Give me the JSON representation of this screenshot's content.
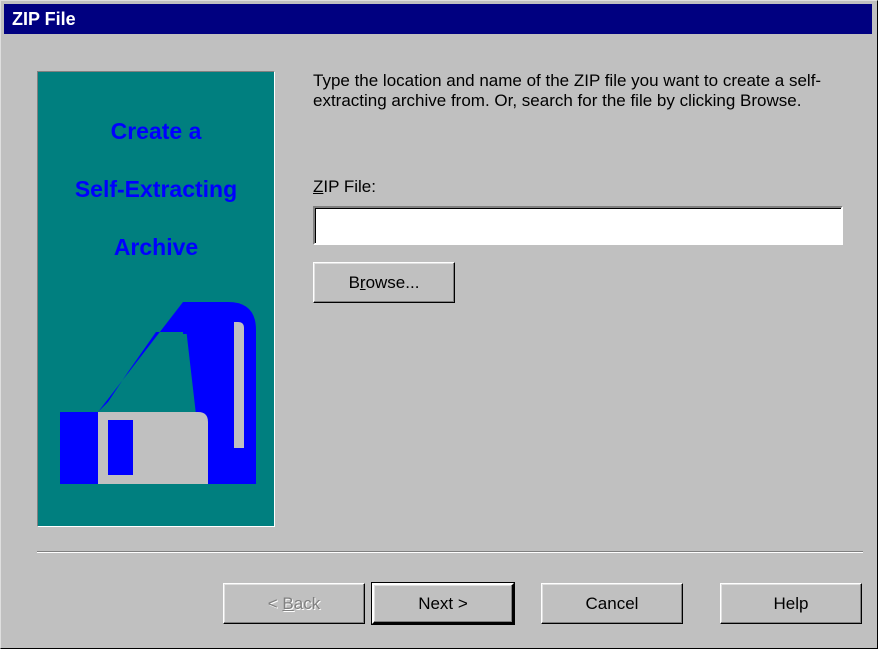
{
  "window": {
    "title": "ZIP File"
  },
  "banner": {
    "lines": [
      "Create a",
      "Self-Extracting",
      "Archive"
    ],
    "icon": "floppy-disk-icon",
    "colors": {
      "background": "#007f7f",
      "text": "#0000ff"
    }
  },
  "instructions": "Type the location and name of the ZIP file you want to create a self-extracting archive from.  Or, search for the file by clicking Browse.",
  "zip_field": {
    "label_mnemonic": "Z",
    "label_rest": "IP File:",
    "value": ""
  },
  "browse": {
    "mnemonic": "r",
    "before": "B",
    "after": "owse..."
  },
  "nav": {
    "back": {
      "before": "< ",
      "mnemonic": "B",
      "after": "ack",
      "disabled": true
    },
    "next": "Next >",
    "cancel": "Cancel",
    "help": "Help"
  }
}
